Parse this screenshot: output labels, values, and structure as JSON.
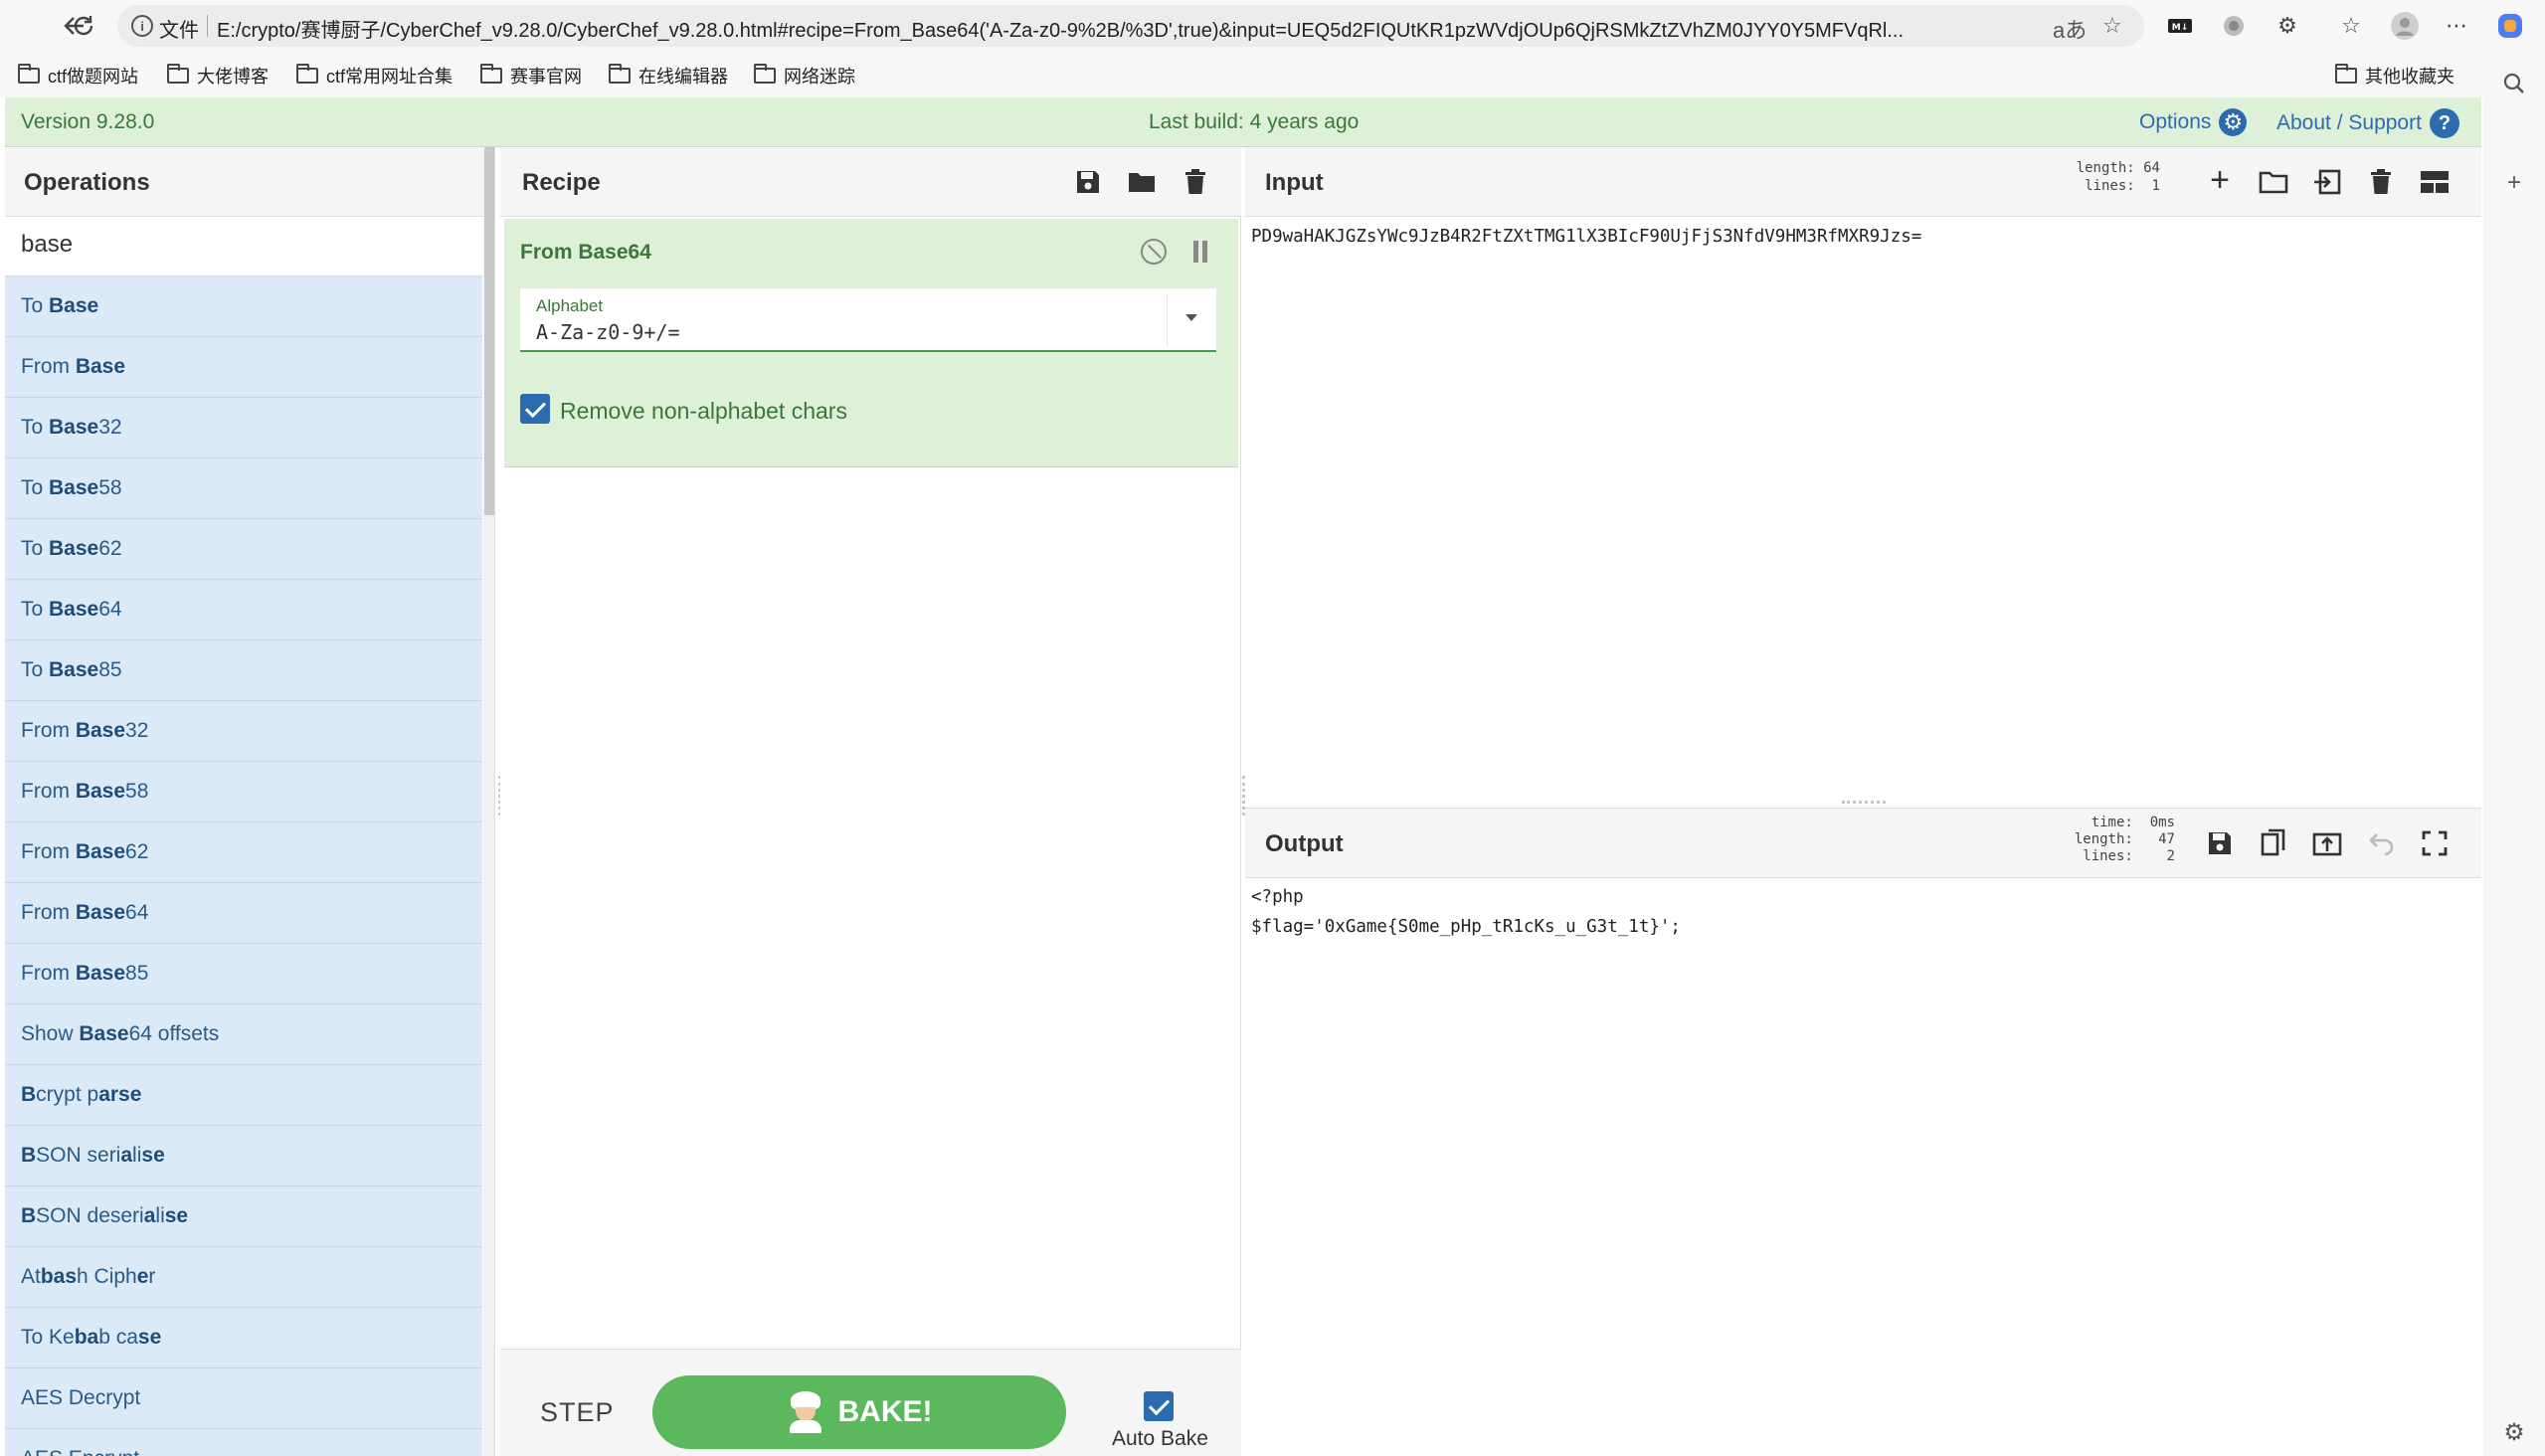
{
  "browser": {
    "address_chip": "文件",
    "url": "E:/crypto/赛博厨子/CyberChef_v9.28.0/CyberChef_v9.28.0.html#recipe=From_Base64('A-Za-z0-9%2B/%3D',true)&input=UEQ5d2FIQUtKR1pzWVdjOUp6QjRSMkZtZVhZM0JYY0Y5MFVqRl...",
    "bookmarks": [
      "ctf做题网站",
      "大佬博客",
      "ctf常用网址合集",
      "赛事官网",
      "在线编辑器",
      "网络迷踪"
    ],
    "other_bookmarks": "其他收藏夹"
  },
  "banner": {
    "version": "Version 9.28.0",
    "last_build": "Last build: 4 years ago",
    "options": "Options",
    "about": "About / Support"
  },
  "operations": {
    "title": "Operations",
    "search_value": "base",
    "items": [
      {
        "pre": "To ",
        "match": "Base",
        "post": ""
      },
      {
        "pre": "From ",
        "match": "Base",
        "post": ""
      },
      {
        "pre": "To ",
        "match": "Base",
        "post": "32"
      },
      {
        "pre": "To ",
        "match": "Base",
        "post": "58"
      },
      {
        "pre": "To ",
        "match": "Base",
        "post": "62"
      },
      {
        "pre": "To ",
        "match": "Base",
        "post": "64"
      },
      {
        "pre": "To ",
        "match": "Base",
        "post": "85"
      },
      {
        "pre": "From ",
        "match": "Base",
        "post": "32"
      },
      {
        "pre": "From ",
        "match": "Base",
        "post": "58"
      },
      {
        "pre": "From ",
        "match": "Base",
        "post": "62"
      },
      {
        "pre": "From ",
        "match": "Base",
        "post": "64"
      },
      {
        "pre": "From ",
        "match": "Base",
        "post": "85"
      },
      {
        "pre": "Show ",
        "match": "Base",
        "post": "64 offsets"
      },
      {
        "html": "<b>B</b>crypt p<b>arse</b>"
      },
      {
        "html": "<b>B</b>SON seri<b>a</b>li<b>se</b>"
      },
      {
        "html": "<b>B</b>SON deseri<b>a</b>li<b>se</b>"
      },
      {
        "html": "At<b>bas</b>h Ciph<b>e</b>r"
      },
      {
        "html": "To Ke<b>ba</b>b ca<b>se</b>"
      },
      {
        "html": "AES Decrypt"
      },
      {
        "html": "AES Encrypt"
      }
    ]
  },
  "recipe": {
    "title": "Recipe",
    "operation": "From Base64",
    "alphabet_label": "Alphabet",
    "alphabet_value": "A-Za-z0-9+/=",
    "remove_label": "Remove non-alphabet chars",
    "remove_checked": true,
    "step": "STEP",
    "bake": "BAKE!",
    "auto_bake": "Auto Bake"
  },
  "input": {
    "title": "Input",
    "stats": "length: 64\n lines:  1",
    "text": "PD9waHAKJGZsYWc9JzB4R2FtZXtTMG1lX3BIcF90UjFjS3NfdV9HM3RfMXR9Jzs="
  },
  "output": {
    "title": "Output",
    "stats": "  time:  0ms\nlength:   47\n lines:    2",
    "text": "<?php\n$flag='0xGame{S0me_pHp_tR1cKs_u_G3t_1t}';"
  }
}
